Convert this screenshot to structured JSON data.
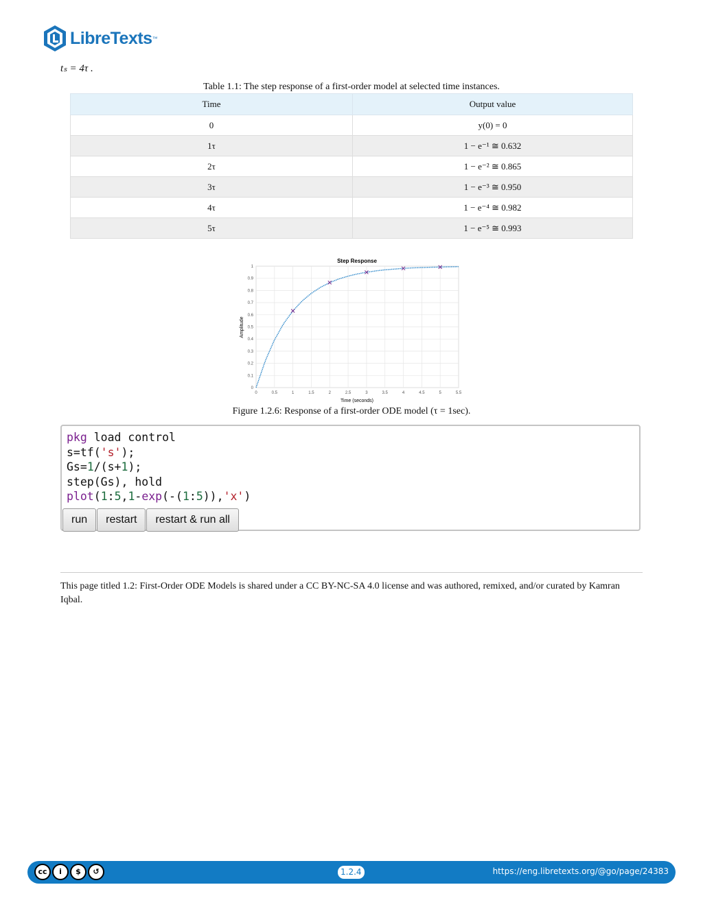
{
  "header": {
    "logo_text": "LibreTexts",
    "logo_tm": "™"
  },
  "equation": "tₛ = 4τ .",
  "table": {
    "caption": "Table 1.1: The step response of a first-order model at selected time instances.",
    "headers": [
      "Time",
      "Output value"
    ],
    "rows": [
      {
        "time": "0",
        "output": "y(0) = 0"
      },
      {
        "time": "1τ",
        "output": "1 − e⁻¹ ≅ 0.632"
      },
      {
        "time": "2τ",
        "output": "1 − e⁻² ≅ 0.865"
      },
      {
        "time": "3τ",
        "output": "1 − e⁻³ ≅ 0.950"
      },
      {
        "time": "4τ",
        "output": "1 − e⁻⁴ ≅ 0.982"
      },
      {
        "time": "5τ",
        "output": "1 − e⁻⁵ ≅ 0.993"
      }
    ]
  },
  "chart_data": {
    "type": "line",
    "title": "Step Response",
    "xlabel": "Time (seconds)",
    "ylabel": "Amplitude",
    "xlim": [
      0,
      5.5
    ],
    "ylim": [
      0,
      1
    ],
    "xticks": [
      "0",
      "0.5",
      "1",
      "1.5",
      "2",
      "2.5",
      "3",
      "3.5",
      "4",
      "4.5",
      "5",
      "5.5"
    ],
    "yticks": [
      "0",
      "0.1",
      "0.2",
      "0.3",
      "0.4",
      "0.5",
      "0.6",
      "0.7",
      "0.8",
      "0.9",
      "1"
    ],
    "grid": true,
    "series": [
      {
        "style": "line",
        "color": "#2a86c9",
        "x": [
          0,
          0.25,
          0.5,
          0.75,
          1,
          1.25,
          1.5,
          1.75,
          2,
          2.25,
          2.5,
          2.75,
          3,
          3.25,
          3.5,
          3.75,
          4,
          4.25,
          4.5,
          4.75,
          5,
          5.25,
          5.5
        ],
        "y": [
          0,
          0.221,
          0.393,
          0.528,
          0.632,
          0.713,
          0.777,
          0.826,
          0.865,
          0.895,
          0.918,
          0.936,
          0.95,
          0.961,
          0.97,
          0.976,
          0.982,
          0.986,
          0.989,
          0.991,
          0.993,
          0.995,
          0.996
        ]
      },
      {
        "style": "markers",
        "marker": "x",
        "color": "#7a2e8e",
        "x": [
          1,
          2,
          3,
          4,
          5
        ],
        "y": [
          0.632,
          0.865,
          0.95,
          0.982,
          0.993
        ]
      }
    ]
  },
  "figure_caption": "Figure 1.2.6: Response of a first-order ODE model (τ = 1sec).",
  "code": {
    "line1": {
      "kw": "pkg",
      "rest": " load control"
    },
    "line2": {
      "a": "s=tf(",
      "s": "'s'",
      "b": ");"
    },
    "line3": {
      "a": "Gs=",
      "n1": "1",
      "b": "/(s+",
      "n2": "1",
      "c": ");"
    },
    "line4": "step(Gs), hold",
    "line5": {
      "kw": "plot",
      "a": "(",
      "n1": "1",
      "b": ":",
      "n2": "5",
      "c": ",",
      "n3": "1",
      "d": "-",
      "kw2": "exp",
      "e": "(-(",
      "n4": "1",
      "f": ":",
      "n5": "5",
      "g": ")),",
      "s": "'x'",
      "h": ")"
    },
    "buttons": {
      "run": "run",
      "restart": "restart",
      "restart_run_all": "restart & run all"
    }
  },
  "license": "This page titled 1.2: First-Order ODE Models is shared under a CC BY-NC-SA 4.0 license and was authored, remixed, and/or curated by Kamran Iqbal.",
  "footer": {
    "cc_icons": [
      "cc-icon",
      "by-icon",
      "nc-icon",
      "sa-icon"
    ],
    "cc_glyphs": [
      "cc",
      "i",
      "$",
      "↺"
    ],
    "page_number": "1.2.4",
    "url": "https://eng.libretexts.org/@go/page/24383"
  }
}
